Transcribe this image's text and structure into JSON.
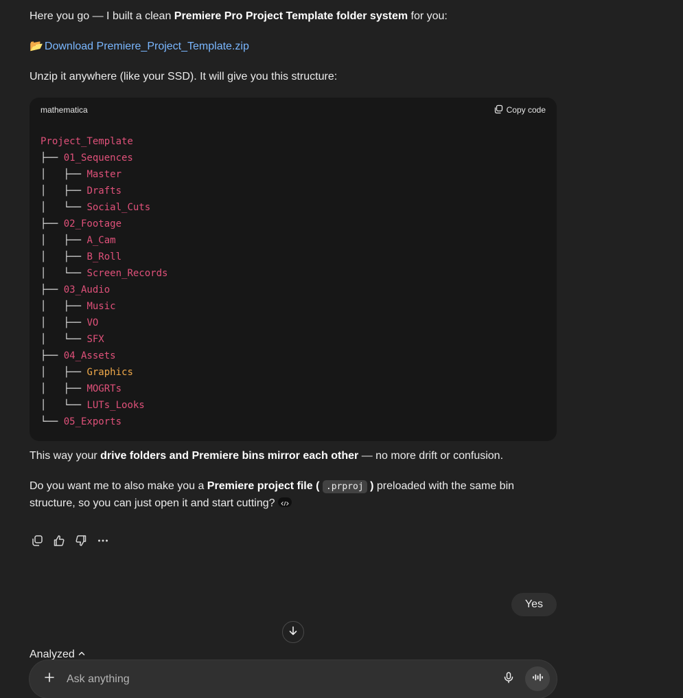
{
  "message": {
    "intro_prefix": "Here you go — I built a clean ",
    "intro_bold": "Premiere Pro Project Template folder system",
    "intro_suffix": " for you:",
    "download_icon": "📂",
    "download_link": "Download Premiere_Project_Template.zip",
    "unzip_text": "Unzip it anywhere (like your SSD). It will give you this structure:",
    "outro_prefix": "This way your ",
    "outro_bold": "drive folders and Premiere bins mirror each other",
    "outro_suffix": " — no more drift or confusion.",
    "question_prefix": "Do you want me to also make you a ",
    "question_bold_a": "Premiere project file (",
    "question_code": ".prproj",
    "question_bold_b": ")",
    "question_suffix": " preloaded with the same bin structure, so you can just open it and start cutting?"
  },
  "code_block": {
    "language": "mathematica",
    "copy_label": "Copy code",
    "lines": [
      {
        "prefix": "",
        "name": "Project_Template"
      },
      {
        "prefix": "├── ",
        "name": "01_Sequences"
      },
      {
        "prefix": "│   ├── ",
        "name": "Master"
      },
      {
        "prefix": "│   ├── ",
        "name": "Drafts"
      },
      {
        "prefix": "│   └── ",
        "name": "Social_Cuts"
      },
      {
        "prefix": "├── ",
        "name": "02_Footage"
      },
      {
        "prefix": "│   ├── ",
        "name": "A_Cam"
      },
      {
        "prefix": "│   ├── ",
        "name": "B_Roll"
      },
      {
        "prefix": "│   └── ",
        "name": "Screen_Records"
      },
      {
        "prefix": "├── ",
        "name": "03_Audio"
      },
      {
        "prefix": "│   ├── ",
        "name": "Music"
      },
      {
        "prefix": "│   ├── ",
        "name": "VO"
      },
      {
        "prefix": "│   └── ",
        "name": "SFX"
      },
      {
        "prefix": "├── ",
        "name": "04_Assets"
      },
      {
        "prefix": "│   ├── ",
        "name": "Graphics",
        "highlight": true
      },
      {
        "prefix": "│   ├── ",
        "name": "MOGRTs"
      },
      {
        "prefix": "│   └── ",
        "name": "LUTs_Looks"
      },
      {
        "prefix": "└── ",
        "name": "05_Exports"
      }
    ]
  },
  "user_message": "Yes",
  "analyzed_label": "Analyzed",
  "composer": {
    "placeholder": "Ask anything"
  },
  "colors": {
    "background": "#212121",
    "code_bg": "#171717",
    "tree_name": "#e0517a",
    "tree_highlight": "#f0a94a",
    "link": "#7ab7ff"
  }
}
